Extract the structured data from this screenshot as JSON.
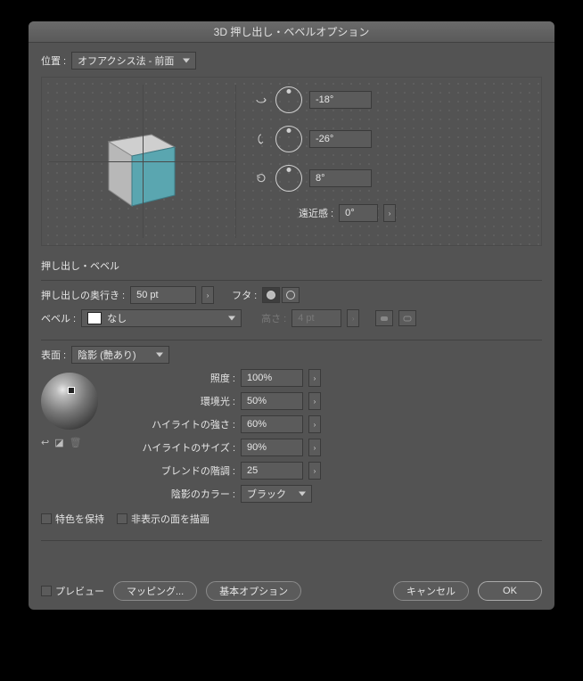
{
  "title": "3D 押し出し・ベベルオプション",
  "position": {
    "label": "位置 :",
    "value": "オフアクシス法 - 前面"
  },
  "rotation": {
    "x": {
      "value": "-18°"
    },
    "y": {
      "value": "-26°"
    },
    "z": {
      "value": "8°"
    }
  },
  "perspective": {
    "label": "遠近感 :",
    "value": "0°"
  },
  "extrude": {
    "section_title": "押し出し・ベベル",
    "depth_label": "押し出しの奥行き :",
    "depth_value": "50 pt",
    "cap_label": "フタ :",
    "bevel_label": "ベベル :",
    "bevel_value": "なし",
    "height_label": "高さ :",
    "height_value": "4 pt"
  },
  "surface": {
    "label": "表面 :",
    "value": "陰影 (艶あり)",
    "intensity_label": "照度 :",
    "intensity_value": "100%",
    "ambient_label": "環境光 :",
    "ambient_value": "50%",
    "highlight_intensity_label": "ハイライトの強さ :",
    "highlight_intensity_value": "60%",
    "highlight_size_label": "ハイライトのサイズ :",
    "highlight_size_value": "90%",
    "blend_steps_label": "ブレンドの階調 :",
    "blend_steps_value": "25",
    "shade_color_label": "陰影のカラー :",
    "shade_color_value": "ブラック"
  },
  "checks": {
    "preserve_spot": "特色を保持",
    "draw_hidden": "非表示の面を描画"
  },
  "footer": {
    "preview": "プレビュー",
    "mapping": "マッピング...",
    "basic": "基本オプション",
    "cancel": "キャンセル",
    "ok": "OK"
  }
}
